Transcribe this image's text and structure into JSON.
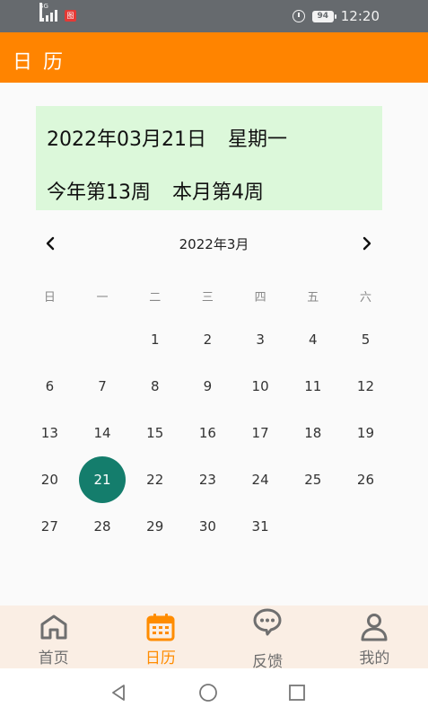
{
  "status_bar": {
    "network_tag": "4G",
    "app_badge": "图",
    "battery": "94",
    "time": "12:20",
    "icons": [
      "signal-icon",
      "alarm-icon",
      "battery-icon"
    ]
  },
  "app_bar": {
    "title": "日历"
  },
  "info_card": {
    "date_text": "2022年03月21日",
    "weekday_text": "星期一",
    "year_week_text": "今年第13周",
    "month_week_text": "本月第4周"
  },
  "calendar": {
    "month_title": "2022年3月",
    "weekdays": [
      "日",
      "一",
      "二",
      "三",
      "四",
      "五",
      "六"
    ],
    "first_weekday_index": 2,
    "days_in_month": 31,
    "selected_day": 21,
    "prev_icon": "chevron-left-icon",
    "next_icon": "chevron-right-icon",
    "selected_color": "#147d6c"
  },
  "bottom_nav": {
    "items": [
      {
        "label": "首页",
        "icon": "home-icon",
        "active": false
      },
      {
        "label": "日历",
        "icon": "calendar-icon",
        "active": true
      },
      {
        "label": "反馈",
        "icon": "feedback-icon",
        "active": false
      },
      {
        "label": "我的",
        "icon": "user-icon",
        "active": false
      }
    ],
    "active_color": "#ff8c00",
    "inactive_color": "#6f6f6f"
  },
  "system_nav": {
    "icons": [
      "back-icon",
      "home-circle-icon",
      "recent-apps-icon"
    ]
  },
  "colors": {
    "accent": "#ff8400",
    "card_background": "#dcf8da",
    "status_bar": "#666a6e",
    "bottom_nav_background": "#faeee4"
  }
}
